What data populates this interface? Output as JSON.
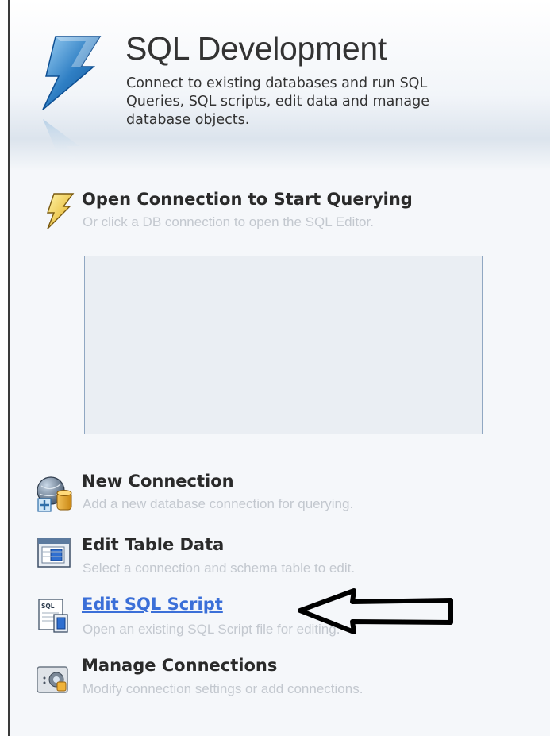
{
  "header": {
    "title": "SQL Development",
    "description": "Connect to existing databases and run SQL Queries, SQL scripts, edit data and manage database objects."
  },
  "open_connection": {
    "title": "Open Connection to Start Querying",
    "subtitle": "Or click a DB connection to open the SQL Editor.",
    "connections": []
  },
  "actions": [
    {
      "title": "New Connection",
      "subtitle": "Add a new database connection for querying.",
      "icon": "new-connection-icon",
      "is_link": false
    },
    {
      "title": "Edit Table Data",
      "subtitle": "Select a connection and schema table to edit.",
      "icon": "table-icon",
      "is_link": false
    },
    {
      "title": "Edit SQL Script",
      "subtitle": "Open an existing SQL Script file for editing.",
      "icon": "sql-script-icon",
      "is_link": true
    },
    {
      "title": "Manage Connections",
      "subtitle": "Modify connection settings or add connections.",
      "icon": "manage-connections-icon",
      "is_link": false
    }
  ],
  "annotation": {
    "type": "arrow",
    "direction": "left",
    "color": "#000000"
  },
  "colors": {
    "link": "#3b6fd8",
    "subtitle": "#c3c8cf",
    "box_border": "#90a7c2"
  }
}
